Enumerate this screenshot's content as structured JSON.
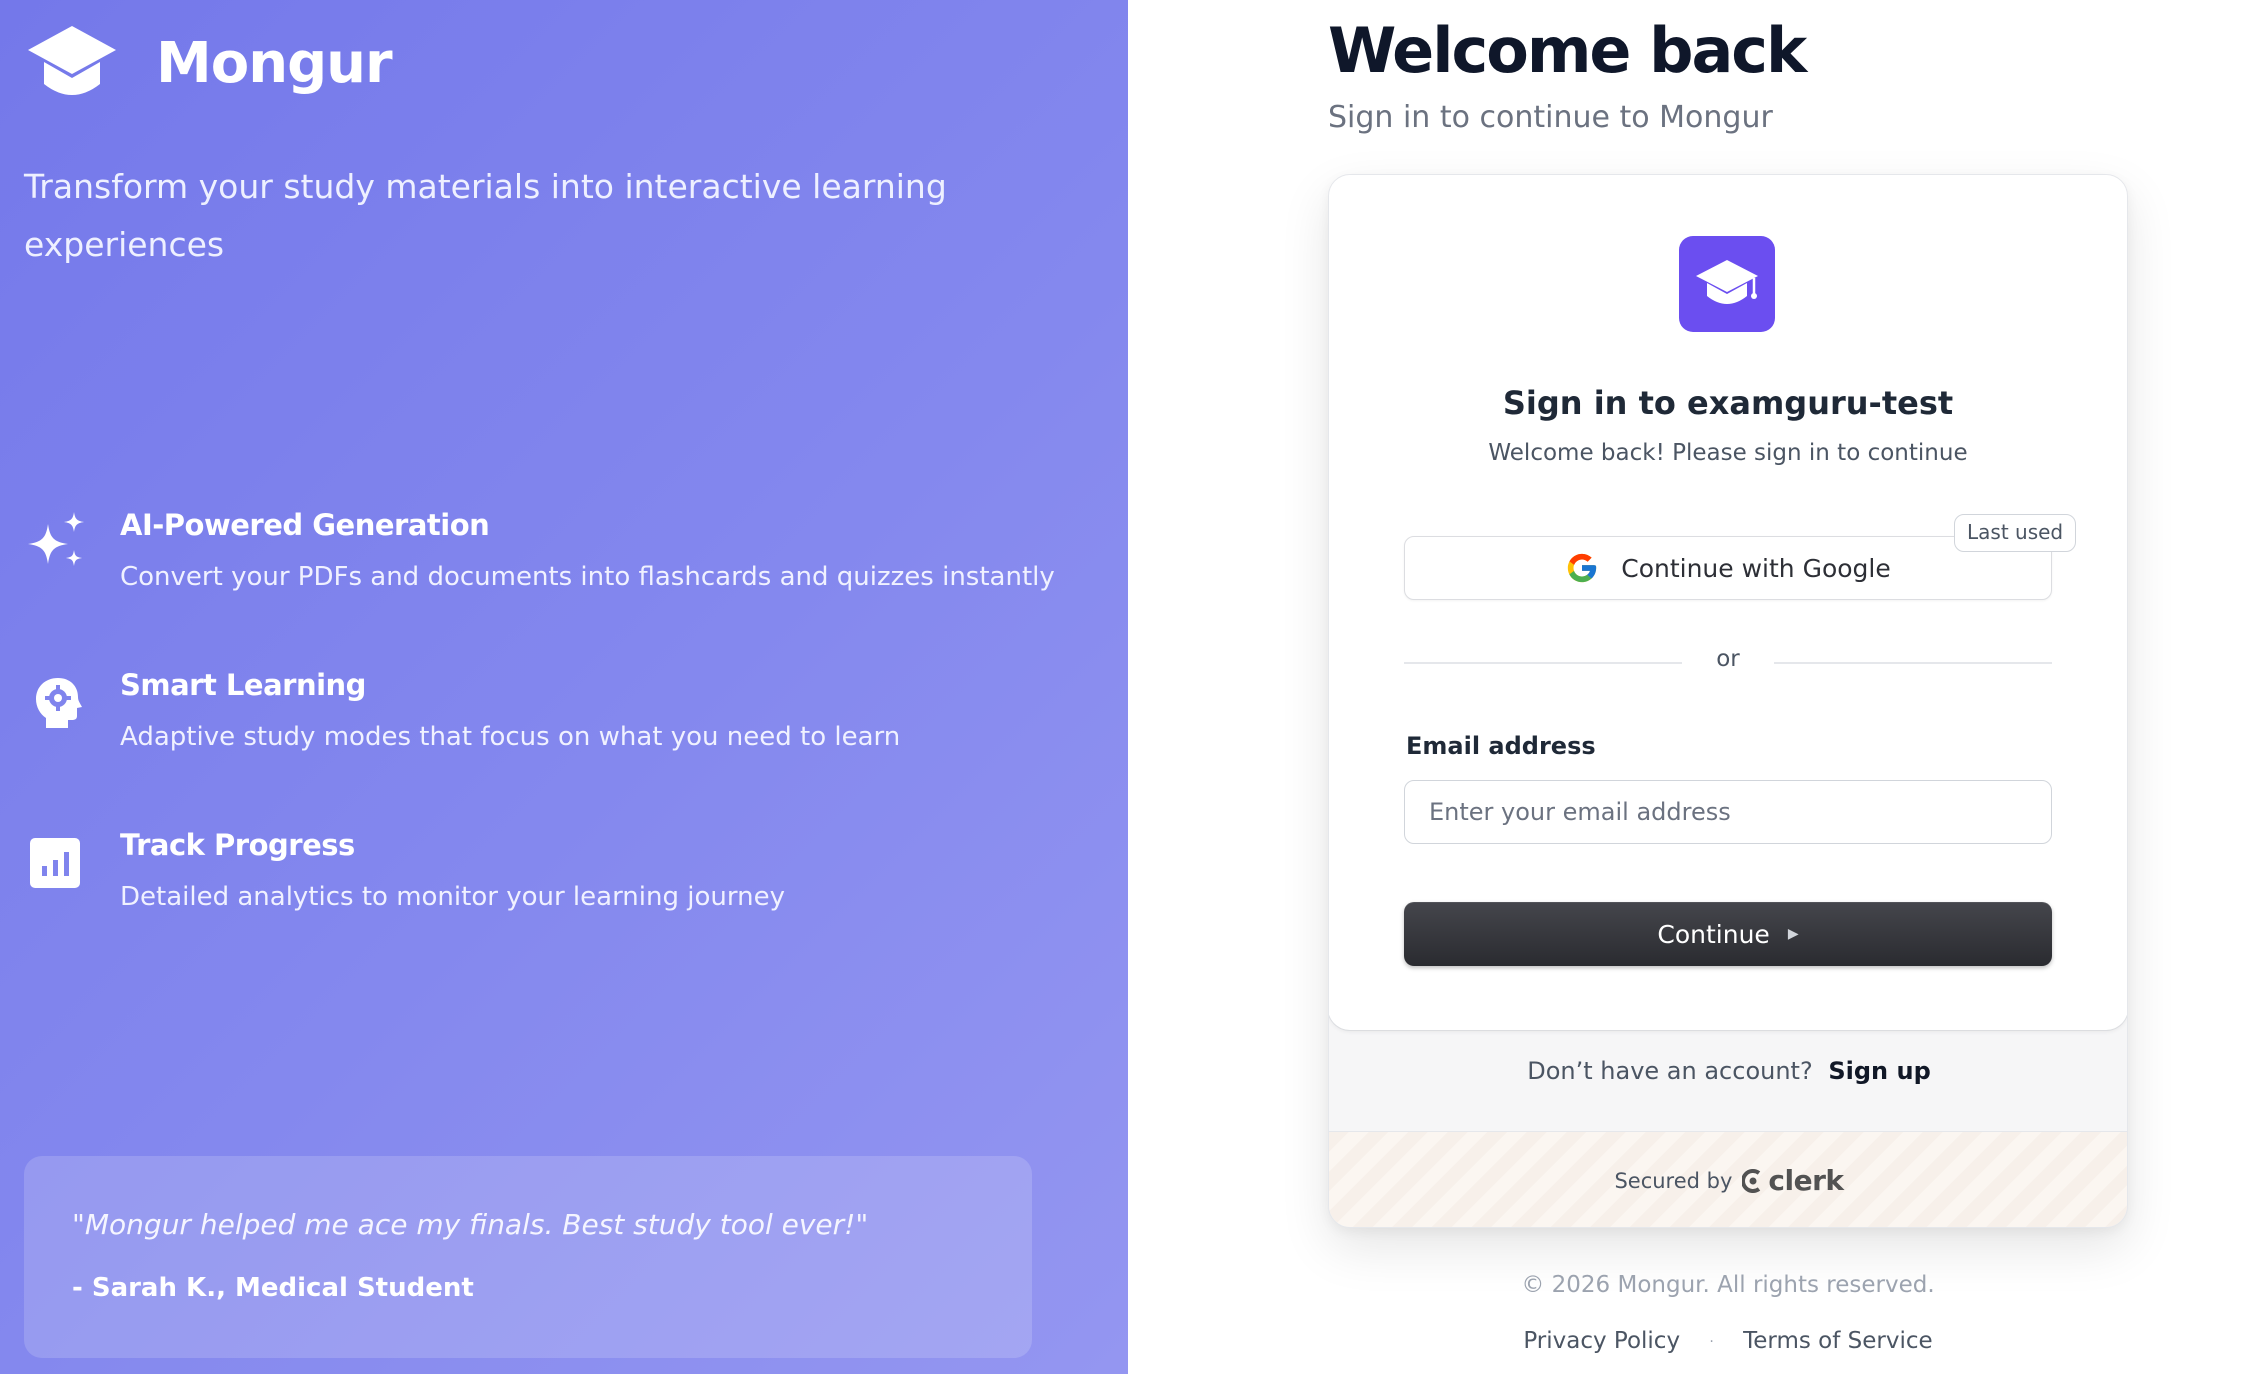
{
  "brand": {
    "name": "Mongur",
    "tagline": "Transform your study materials into interactive learning experiences",
    "icon": "graduation-cap-icon"
  },
  "features": [
    {
      "icon": "sparkles-icon",
      "title": "AI-Powered Generation",
      "description": "Convert your PDFs and documents into flashcards and quizzes instantly"
    },
    {
      "icon": "brain-gear-icon",
      "title": "Smart Learning",
      "description": "Adaptive study modes that focus on what you need to learn"
    },
    {
      "icon": "bar-chart-icon",
      "title": "Track Progress",
      "description": "Detailed analytics to monitor your learning journey"
    }
  ],
  "testimonial": {
    "quote": "\"Mongur helped me ace my finals. Best study tool ever!\"",
    "author": "- Sarah K., Medical Student"
  },
  "header": {
    "title": "Welcome back",
    "subtitle": "Sign in to continue to Mongur"
  },
  "card": {
    "title": "Sign in to examguru-test",
    "subtitle": "Welcome back! Please sign in to continue",
    "google_button": "Continue with Google",
    "last_used_badge": "Last used",
    "divider_text": "or",
    "email_label": "Email address",
    "email_placeholder": "Enter your email address",
    "email_value": "",
    "continue_button": "Continue",
    "signup_prompt": "Don’t have an account?",
    "signup_link": "Sign up",
    "secured_by": "Secured by",
    "clerk_brand": "clerk"
  },
  "footer": {
    "copyright": "© 2026 Mongur. All rights reserved.",
    "privacy": "Privacy Policy",
    "separator": "·",
    "terms": "Terms of Service"
  },
  "colors": {
    "left_panel_start": "#7478ea",
    "left_panel_end": "#9496f1",
    "app_logo_bg": "#6b4ef0",
    "continue_button_bg": "#2f3035",
    "heading": "#0f172a"
  }
}
